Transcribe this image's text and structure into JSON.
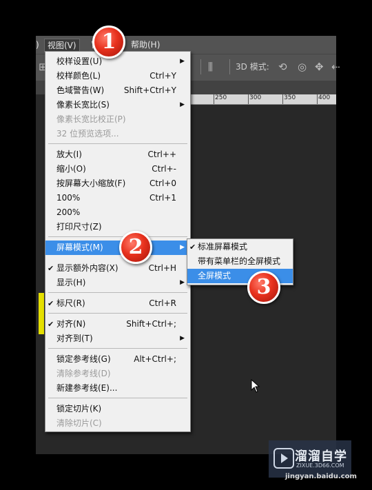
{
  "menubar": {
    "partial_left": ")",
    "view": "视图(V)",
    "hidden_item": "窗",
    "help": "帮助(H)"
  },
  "options_bar": {
    "label_3d": "3D 模式:"
  },
  "ruler": {
    "labels": [
      "250",
      "300",
      "350",
      "400"
    ]
  },
  "view_menu": {
    "items": [
      {
        "label": "校样设置(U)",
        "shortcut": "",
        "submenu": true
      },
      {
        "label": "校样颜色(L)",
        "shortcut": "Ctrl+Y"
      },
      {
        "label": "色域警告(W)",
        "shortcut": "Shift+Ctrl+Y"
      },
      {
        "label": "像素长宽比(S)",
        "shortcut": "",
        "submenu": true
      },
      {
        "label": "像素长宽比校正(P)",
        "shortcut": "",
        "disabled": true
      },
      {
        "label": "32 位预览选项...",
        "shortcut": "",
        "disabled": true
      },
      {
        "label": "放大(I)",
        "shortcut": "Ctrl++"
      },
      {
        "label": "缩小(O)",
        "shortcut": "Ctrl+-"
      },
      {
        "label": "按屏幕大小缩放(F)",
        "shortcut": "Ctrl+0"
      },
      {
        "label": "100%",
        "shortcut": "Ctrl+1"
      },
      {
        "label": "200%",
        "shortcut": ""
      },
      {
        "label": "打印尺寸(Z)",
        "shortcut": ""
      },
      {
        "label": "屏幕模式(M)",
        "shortcut": "",
        "submenu": true,
        "active": true
      },
      {
        "label": "显示额外内容(X)",
        "shortcut": "Ctrl+H",
        "checked": true
      },
      {
        "label": "显示(H)",
        "shortcut": "",
        "submenu": true
      },
      {
        "label": "标尺(R)",
        "shortcut": "Ctrl+R",
        "checked": true
      },
      {
        "label": "对齐(N)",
        "shortcut": "Shift+Ctrl+;",
        "checked": true
      },
      {
        "label": "对齐到(T)",
        "shortcut": "",
        "submenu": true
      },
      {
        "label": "锁定参考线(G)",
        "shortcut": "Alt+Ctrl+;"
      },
      {
        "label": "清除参考线(D)",
        "shortcut": "",
        "disabled": true
      },
      {
        "label": "新建参考线(E)...",
        "shortcut": ""
      },
      {
        "label": "锁定切片(K)",
        "shortcut": ""
      },
      {
        "label": "清除切片(C)",
        "shortcut": "",
        "disabled": true
      }
    ]
  },
  "screen_mode_submenu": {
    "items": [
      {
        "label": "标准屏幕模式",
        "checked": true
      },
      {
        "label": "带有菜单栏的全屏模式"
      },
      {
        "label": "全屏模式",
        "active": true
      }
    ]
  },
  "badges": [
    "1",
    "2",
    "3"
  ],
  "watermark": {
    "title": "溜溜自学",
    "url": "ZIXUE.3D66.COM",
    "bottom": "jingyan.baidu.com"
  },
  "colors": {
    "highlight": "#3b8ee8",
    "badge_red": "#e8321e",
    "menu_bg": "#f0f0f0",
    "app_bg": "#282828"
  }
}
